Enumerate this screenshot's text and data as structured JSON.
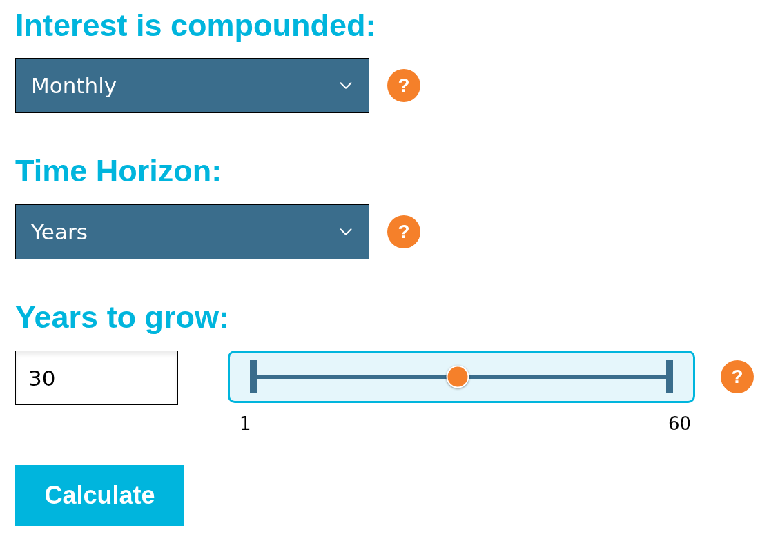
{
  "sections": [
    {
      "kind": "select",
      "label": "Interest is compounded:",
      "value": "Monthly",
      "help": "?"
    },
    {
      "kind": "select",
      "label": "Time Horizon:",
      "value": "Years",
      "help": "?"
    },
    {
      "kind": "slider",
      "label": "Years to grow:",
      "value": "30",
      "level": 0.49,
      "min_label": "1",
      "max_label": "60",
      "help": "?"
    }
  ],
  "button": "Calculate"
}
